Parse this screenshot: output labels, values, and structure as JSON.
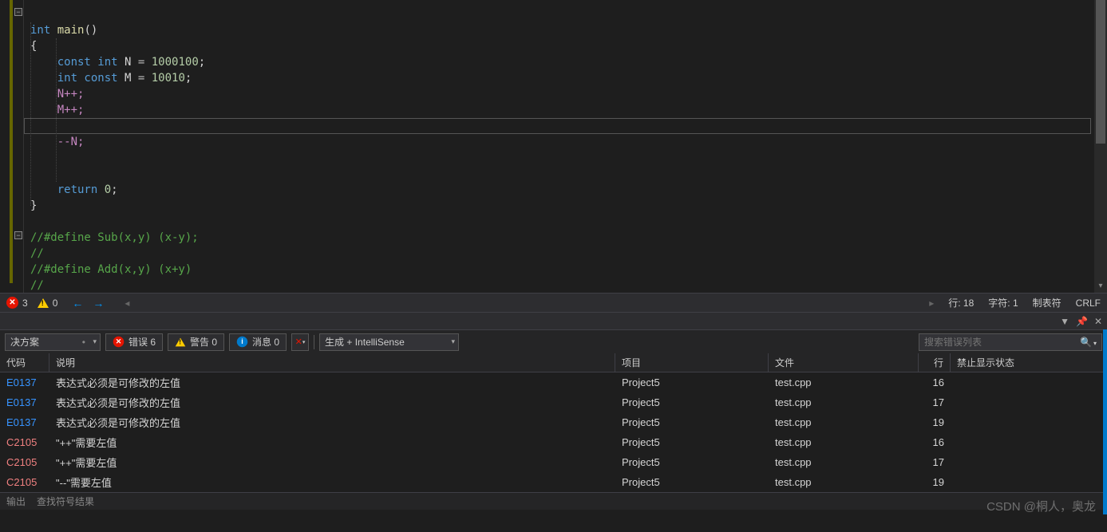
{
  "code": {
    "line1_int": "int",
    "line1_main": " main",
    "line1_paren": "()",
    "line2": "{",
    "line3_kw": "    const int",
    "line3_var": " N ",
    "line3_eq": "=",
    "line3_num": " 1000100",
    "line3_semi": ";",
    "line4_kw": "    int const",
    "line4_var": " M ",
    "line4_eq": "=",
    "line4_num": " 10010",
    "line4_semi": ";",
    "line5": "    N++;",
    "line6": "    M++;",
    "line7": "",
    "line8": "    --N;",
    "line9": "",
    "line10": "",
    "line11_ret": "    return",
    "line11_num": " 0",
    "line11_semi": ";",
    "line12": "}",
    "comment1": "//#define Sub(x,y) (x-y);",
    "comment2": "//",
    "comment3": "//#define Add(x,y) (x+y)",
    "comment4": "//"
  },
  "status": {
    "errors": "3",
    "warnings": "0",
    "line_label": "行: 18",
    "char_label": "字符: 1",
    "tabs_label": "制表符",
    "lineend": "CRLF"
  },
  "toolbar": {
    "solution": "决方案",
    "errors_btn": "错误 6",
    "warnings_btn": "警告 0",
    "messages_btn": "消息 0",
    "build_intellisense": "生成 + IntelliSense",
    "search_placeholder": "搜索错误列表"
  },
  "headers": {
    "code": "代码",
    "desc": "说明",
    "project": "项目",
    "file": "文件",
    "line": "行",
    "suppress": "禁止显示状态"
  },
  "errors": [
    {
      "code": "E0137",
      "cls": "code-e",
      "desc": "表达式必须是可修改的左值",
      "project": "Project5",
      "file": "test.cpp",
      "line": "16"
    },
    {
      "code": "E0137",
      "cls": "code-e",
      "desc": "表达式必须是可修改的左值",
      "project": "Project5",
      "file": "test.cpp",
      "line": "17"
    },
    {
      "code": "E0137",
      "cls": "code-e",
      "desc": "表达式必须是可修改的左值",
      "project": "Project5",
      "file": "test.cpp",
      "line": "19"
    },
    {
      "code": "C2105",
      "cls": "code-c",
      "desc": "\"++\"需要左值",
      "project": "Project5",
      "file": "test.cpp",
      "line": "16"
    },
    {
      "code": "C2105",
      "cls": "code-c",
      "desc": "\"++\"需要左值",
      "project": "Project5",
      "file": "test.cpp",
      "line": "17"
    },
    {
      "code": "C2105",
      "cls": "code-c",
      "desc": "\"--\"需要左值",
      "project": "Project5",
      "file": "test.cpp",
      "line": "19"
    }
  ],
  "tabs": {
    "output": "输出",
    "findresults": "查找符号结果"
  },
  "watermark": "CSDN @桐人，奥龙"
}
